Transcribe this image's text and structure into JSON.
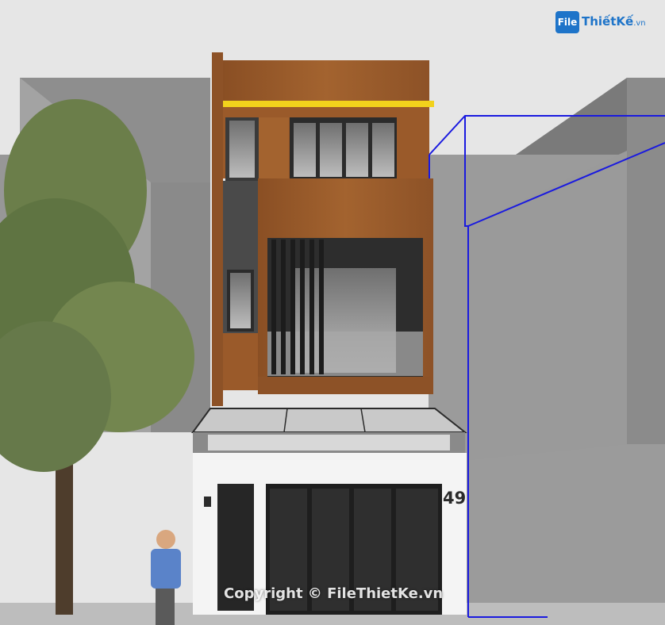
{
  "logo": {
    "mark": "File",
    "name": "ThiếtKế",
    "tld": ".vn"
  },
  "house_number": "49",
  "watermark": "Copyright © FileThietKe.vn",
  "colors": {
    "sky": "#e6e6e6",
    "neighbor_building": "#8f8f8f",
    "wood_cladding": "#9a5a2a",
    "accent_strip": "#f2d21c",
    "window_frame": "#2b2b2b",
    "ground_floor_wall": "#f4f4f4",
    "selection_box": "#1a1adf",
    "tree_foliage": "#6b7e4a",
    "logo_blue": "#1e74c9"
  }
}
